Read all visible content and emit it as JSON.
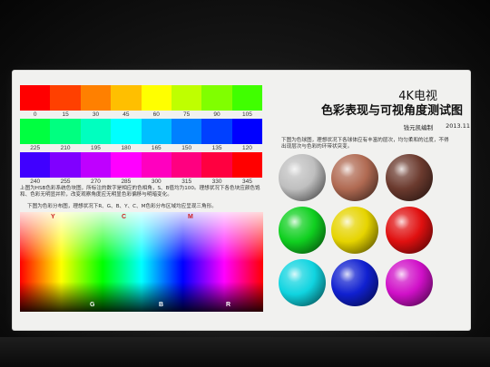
{
  "title": {
    "line1": "4K电视",
    "line2": "色彩表现与可视角度测试图"
  },
  "author": "钱元凯编制",
  "date": "2013.11",
  "hue_rows": [
    {
      "swatches": [
        "#ff0000",
        "#ff4000",
        "#ff8000",
        "#ffbf00",
        "#ffff00",
        "#bfff00",
        "#80ff00",
        "#40ff00"
      ],
      "labels": [
        "0",
        "15",
        "30",
        "45",
        "60",
        "75",
        "90",
        "105"
      ]
    },
    {
      "swatches": [
        "#00ff40",
        "#00ff80",
        "#00ffbf",
        "#00ffff",
        "#00bfff",
        "#0080ff",
        "#0040ff",
        "#0000ff"
      ],
      "labels": [
        "225",
        "210",
        "195",
        "180",
        "165",
        "150",
        "135",
        "120"
      ]
    },
    {
      "swatches": [
        "#4000ff",
        "#8000ff",
        "#bf00ff",
        "#ff00ff",
        "#ff00bf",
        "#ff0080",
        "#ff0040",
        "#ff0000"
      ],
      "labels": [
        "240",
        "255",
        "270",
        "285",
        "300",
        "315",
        "330",
        "345"
      ]
    }
  ],
  "hue_description": "上图为HSB色彩系统色块图，所标注的数字是相应的色相角，S、B值均为100。理想状况下各色块应颜色饱和、色彩无明显并阶，改变观察角度应无明显色彩偏移与明暗变化。",
  "spectrum_description": "下图为色彩分布图，理想状况下R、G、B、Y、C、M色彩分布区域均应呈现三角形。",
  "sphere_description": "下图为色球图，理想状况下各球体应有丰富的层次，均匀柔和的过度，不得出现层次与色彩的环带状突变。",
  "spectrum_labels": {
    "Y": "Y",
    "C": "C",
    "M": "M",
    "G": "G",
    "B": "B",
    "R": "R"
  },
  "spheres": [
    {
      "name": "gray-sphere",
      "color": "#bfbfbf"
    },
    {
      "name": "skin-sphere",
      "color": "#b06a52"
    },
    {
      "name": "brown-sphere",
      "color": "#6b3a2e"
    },
    {
      "name": "green-sphere",
      "color": "#10d020"
    },
    {
      "name": "yellow-sphere",
      "color": "#e6d400"
    },
    {
      "name": "red-sphere",
      "color": "#e01010"
    },
    {
      "name": "cyan-sphere",
      "color": "#10d4e0"
    },
    {
      "name": "blue-sphere",
      "color": "#1020d0"
    },
    {
      "name": "magenta-sphere",
      "color": "#d010c8"
    }
  ]
}
